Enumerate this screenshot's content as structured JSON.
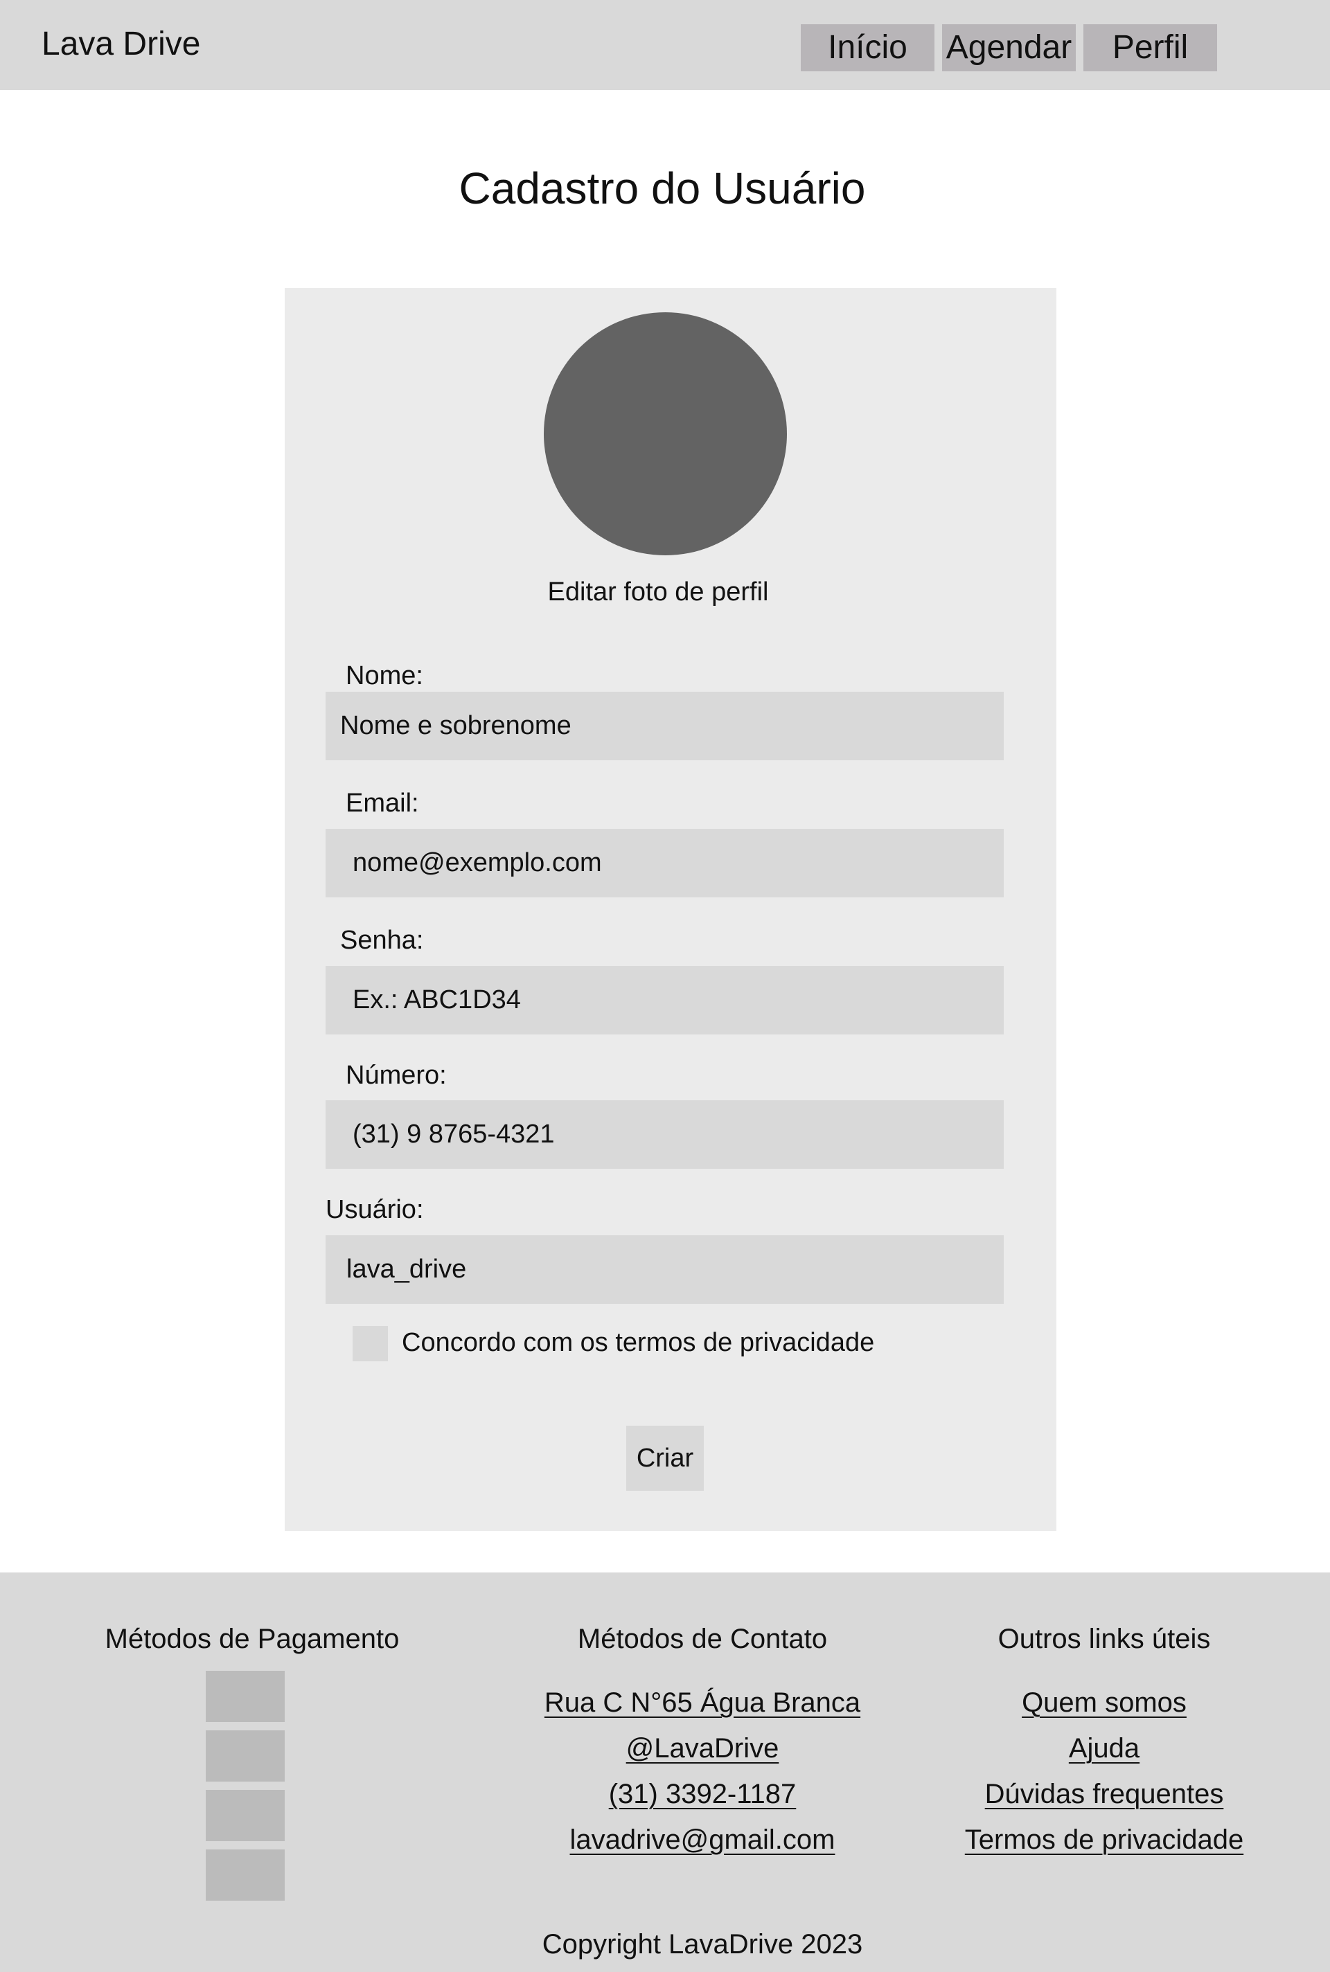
{
  "header": {
    "brand": "Lava Drive",
    "nav": {
      "inicio": "Início",
      "agendar": "Agendar",
      "perfil": "Perfil"
    }
  },
  "page": {
    "title": "Cadastro do Usuário"
  },
  "form": {
    "avatar_icon": "profile-photo-placeholder",
    "edit_photo_label": "Editar foto de perfil",
    "fields": {
      "nome": {
        "label": "Nome:",
        "value": "Nome e sobrenome"
      },
      "email": {
        "label": "Email:",
        "value": "nome@exemplo.com"
      },
      "senha": {
        "label": "Senha:",
        "value": "Ex.: ABC1D34"
      },
      "numero": {
        "label": "Número:",
        "value": "(31) 9 8765-4321"
      },
      "usuario": {
        "label": "Usuário:",
        "value": "lava_drive"
      }
    },
    "privacy_checkbox": {
      "label": "Concordo com os termos de privacidade",
      "checked": false
    },
    "submit_label": "Criar"
  },
  "footer": {
    "payment": {
      "title": "Métodos de Pagamento",
      "methods_count": 4
    },
    "contact": {
      "title": "Métodos de Contato",
      "items": [
        "Rua C N°65 Água Branca",
        "@LavaDrive",
        "(31) 3392-1187",
        "lavadrive@gmail.com"
      ]
    },
    "links": {
      "title": "Outros links úteis",
      "items": [
        "Quem somos",
        "Ajuda",
        "Dúvidas frequentes",
        "Termos de privacidade"
      ]
    },
    "copyright": "Copyright LavaDrive 2023"
  },
  "colors": {
    "header_bg": "#d9d9d9",
    "nav_button_bg": "#b8b5b8",
    "card_bg": "#ebebeb",
    "input_bg": "#d9d9d9",
    "avatar": "#636363",
    "footer_bg": "#d9d9d9",
    "payment_box": "#bbbbbb"
  }
}
